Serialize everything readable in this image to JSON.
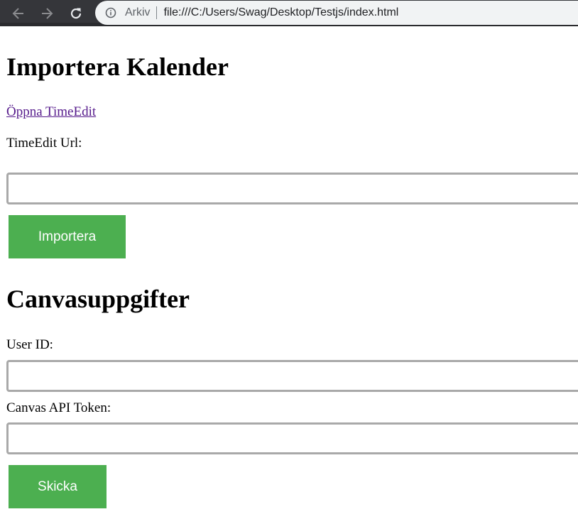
{
  "browser": {
    "security_label": "Arkiv",
    "url": "file:///C:/Users/Swag/Desktop/Testjs/index.html",
    "icons": [
      "back-arrow-icon",
      "forward-arrow-icon",
      "reload-icon",
      "info-icon"
    ]
  },
  "import_section": {
    "title": "Importera Kalender",
    "link_text": "Öppna TimeEdit",
    "url_label": "TimeEdit Url:",
    "url_value": "",
    "button_label": "Importera"
  },
  "canvas_section": {
    "title": "Canvasuppgifter",
    "userid_label": "User ID:",
    "userid_value": "",
    "token_label": "Canvas API Token:",
    "token_value": "",
    "button_label": "Skicka"
  },
  "colors": {
    "button_green": "#4caf50",
    "visited_link": "#551a8b",
    "toolbar": "#35363a",
    "omnibox": "#f1f3f4",
    "input_border": "#a9a9a9"
  }
}
